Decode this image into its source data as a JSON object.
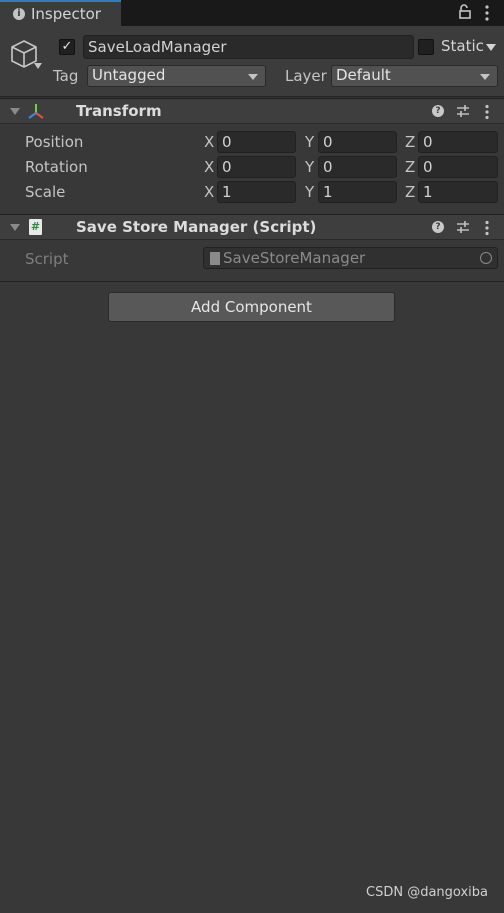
{
  "tab": {
    "title": "Inspector"
  },
  "gameobject": {
    "active": true,
    "name": "SaveLoadManager",
    "static_label": "Static",
    "static_checked": false,
    "tag_label": "Tag",
    "tag_value": "Untagged",
    "layer_label": "Layer",
    "layer_value": "Default"
  },
  "transform": {
    "title": "Transform",
    "rows": [
      {
        "label": "Position",
        "x": "0",
        "y": "0",
        "z": "0"
      },
      {
        "label": "Rotation",
        "x": "0",
        "y": "0",
        "z": "0"
      },
      {
        "label": "Scale",
        "x": "1",
        "y": "1",
        "z": "1"
      }
    ],
    "axis_x": "X",
    "axis_y": "Y",
    "axis_z": "Z"
  },
  "script_component": {
    "title": "Save Store Manager (Script)",
    "script_label": "Script",
    "script_value": "SaveStoreManager",
    "icon_glyph": "#"
  },
  "add_component_label": "Add Component",
  "watermark": "CSDN @dangoxiba",
  "colors": {
    "background": "#383838",
    "header": "#3c3c3c",
    "field": "#2a2a2a",
    "tab_accent": "#3a79bb"
  }
}
